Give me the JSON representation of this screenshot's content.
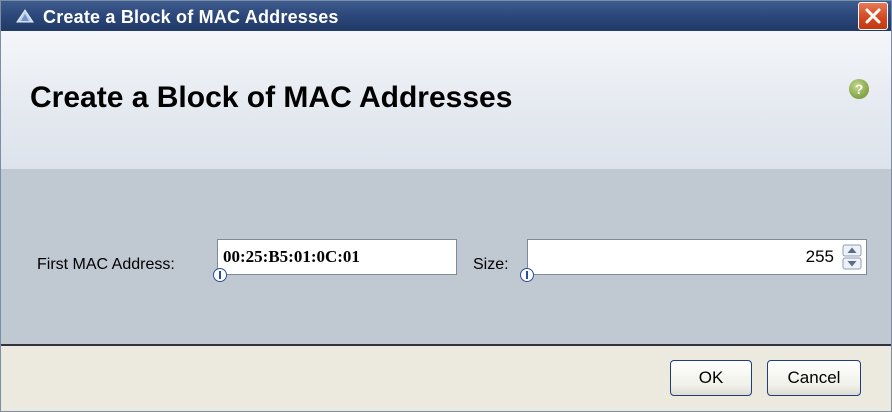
{
  "window": {
    "title": "Create a Block of MAC Addresses",
    "title_icon": "triangle-app-icon",
    "close_icon": "close-icon"
  },
  "header": {
    "heading": "Create a Block of MAC Addresses",
    "help_icon": "help-icon",
    "help_glyph": "?"
  },
  "form": {
    "first_mac_label": "First MAC Address:",
    "first_mac_value": "00:25:B5:01:0C:01",
    "size_label": "Size:",
    "size_value": "255"
  },
  "footer": {
    "ok_label": "OK",
    "cancel_label": "Cancel"
  },
  "colors": {
    "titlebar": "#2a4577",
    "header_bg": "#e4e9f0",
    "form_bg": "#c0c8d2",
    "footer_bg": "#ece9df",
    "close_button": "#d24a22",
    "help_icon": "#8aa94d"
  }
}
